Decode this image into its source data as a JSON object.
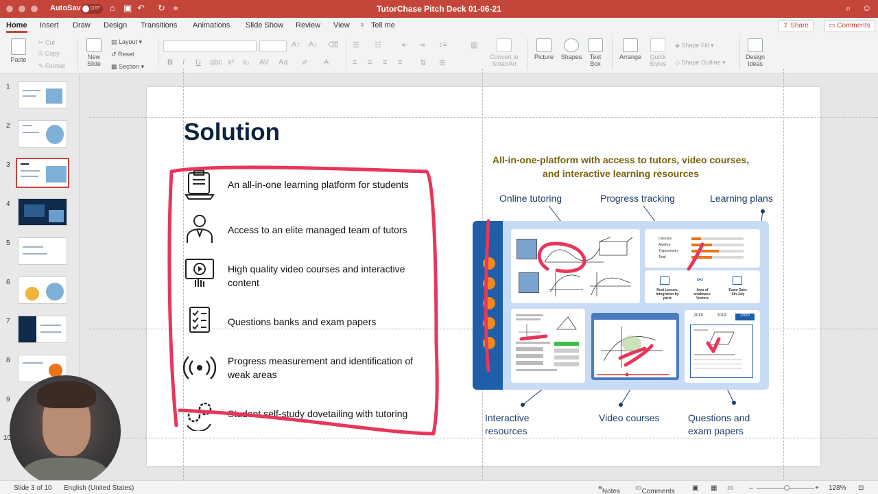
{
  "titlebar": {
    "autosave_label": "AutoSave",
    "autosave_state": "OFF",
    "doc_title": "TutorChase Pitch Deck 01-06-21"
  },
  "tabs": [
    "Home",
    "Insert",
    "Draw",
    "Design",
    "Transitions",
    "Animations",
    "Slide Show",
    "Review",
    "View"
  ],
  "tell_me": "Tell me",
  "share_label": "Share",
  "comments_label": "Comments",
  "ribbon": {
    "paste": "Paste",
    "cut": "Cut",
    "copy": "Copy",
    "format": "Format",
    "new_slide": [
      "New",
      "Slide"
    ],
    "layout": "Layout",
    "reset": "Reset",
    "section": "Section",
    "convert": [
      "Convert to",
      "SmartArt"
    ],
    "picture": "Picture",
    "shapes": "Shapes",
    "textbox": [
      "Text",
      "Box"
    ],
    "arrange": "Arrange",
    "quick_styles": [
      "Quick",
      "Styles"
    ],
    "shape_fill": "Shape Fill",
    "shape_outline": "Shape Outline",
    "design_ideas": [
      "Design",
      "Ideas"
    ]
  },
  "thumbnails": [
    "1",
    "2",
    "3",
    "4",
    "5",
    "6",
    "7",
    "8",
    "9",
    "10"
  ],
  "selected_slide": 3,
  "slide": {
    "title": "Solution",
    "bullets": [
      "An all-in-one learning platform for students",
      "Access to an elite managed team of tutors",
      "High quality video courses and interactive content",
      "Questions banks and exam papers",
      "Progress measurement and identification of weak areas",
      "Student self-study dovetailing with tutoring"
    ],
    "right_heading": [
      "All-in-one-platform with access to tutors, video courses,",
      "and interactive learning resources"
    ],
    "callouts": {
      "online_tutoring": "Online tutoring",
      "progress_tracking": "Progress tracking",
      "learning_plans": "Learning plans",
      "interactive": [
        "Interactive",
        "resources"
      ],
      "video_courses": "Video courses",
      "questions": [
        "Questions and",
        "exam papers"
      ]
    },
    "progress_rows": [
      "Calculus",
      "Algebra",
      "Trigonometry",
      "Total"
    ],
    "progress_values": [
      0.18,
      0.4,
      0.52,
      0.4
    ],
    "info_cards": [
      [
        "Next Lesson:",
        "Integration by",
        "parts"
      ],
      [
        "Area of",
        "weakness:",
        "Vectors"
      ],
      [
        "Exam Date:",
        "5th July"
      ]
    ],
    "year_tabs": [
      "2018",
      "2019",
      "2020"
    ]
  },
  "status": {
    "slide_of": "Slide 3 of 10",
    "language": "English (United States)",
    "notes": "Notes",
    "comments": "Comments",
    "zoom": "128%"
  },
  "colors": {
    "accent": "#c4463a",
    "title": "#0c2340",
    "heading_gold": "#7a6108",
    "callout_blue": "#1c3d6b",
    "annotation_red": "#e8365a",
    "progress_orange": "#e8751a"
  }
}
